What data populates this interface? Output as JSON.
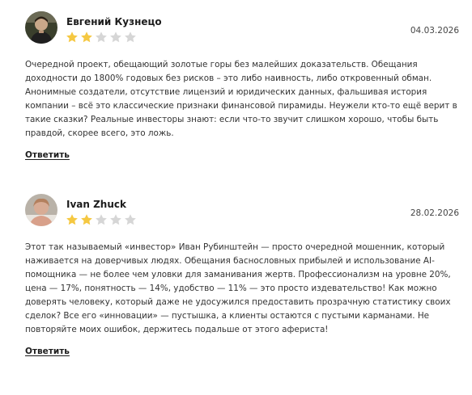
{
  "reviews": [
    {
      "author": "Евгений Кузнецо",
      "rating": 2,
      "max_rating": 5,
      "date": "04.03.2026",
      "text": "Очередной проект, обещающий золотые горы без малейших доказательств. Обещания доходности до 1800% годовых без рисков – это либо наивность, либо откровенный обман. Анонимные создатели, отсутствие лицензий и юридических данных, фальшивая история компании – всё это классические признаки финансовой пирамиды. Неужели кто-то ещё верит в такие сказки? Реальные инвесторы знают: если что-то звучит слишком хорошо, чтобы быть правдой, скорее всего, это ложь.",
      "reply_label": "Ответить"
    },
    {
      "author": "Ivan Zhuck",
      "rating": 2,
      "max_rating": 5,
      "date": "28.02.2026",
      "text": "Этот так называемый «инвестор» Иван Рубинштейн — просто очередной мошенник, который наживается на доверчивых людях. Обещания баснословных прибылей и использование AI-помощника — не более чем уловки для заманивания жертв. Профессионализм на уровне 20%, цена — 17%, понятность — 14%, удобство — 11% — это просто издевательство! Как можно доверять человеку, который даже не удосужился предоставить прозрачную статистику своих сделок? Все его «инновации» — пустышка, а клиенты остаются с пустыми карманами. Не повторяйте моих ошибок, держитесь подальше от этого афериста!",
      "reply_label": "Ответить"
    }
  ],
  "colors": {
    "star_filled": "#f5c842",
    "star_empty": "#d6d6d6"
  }
}
